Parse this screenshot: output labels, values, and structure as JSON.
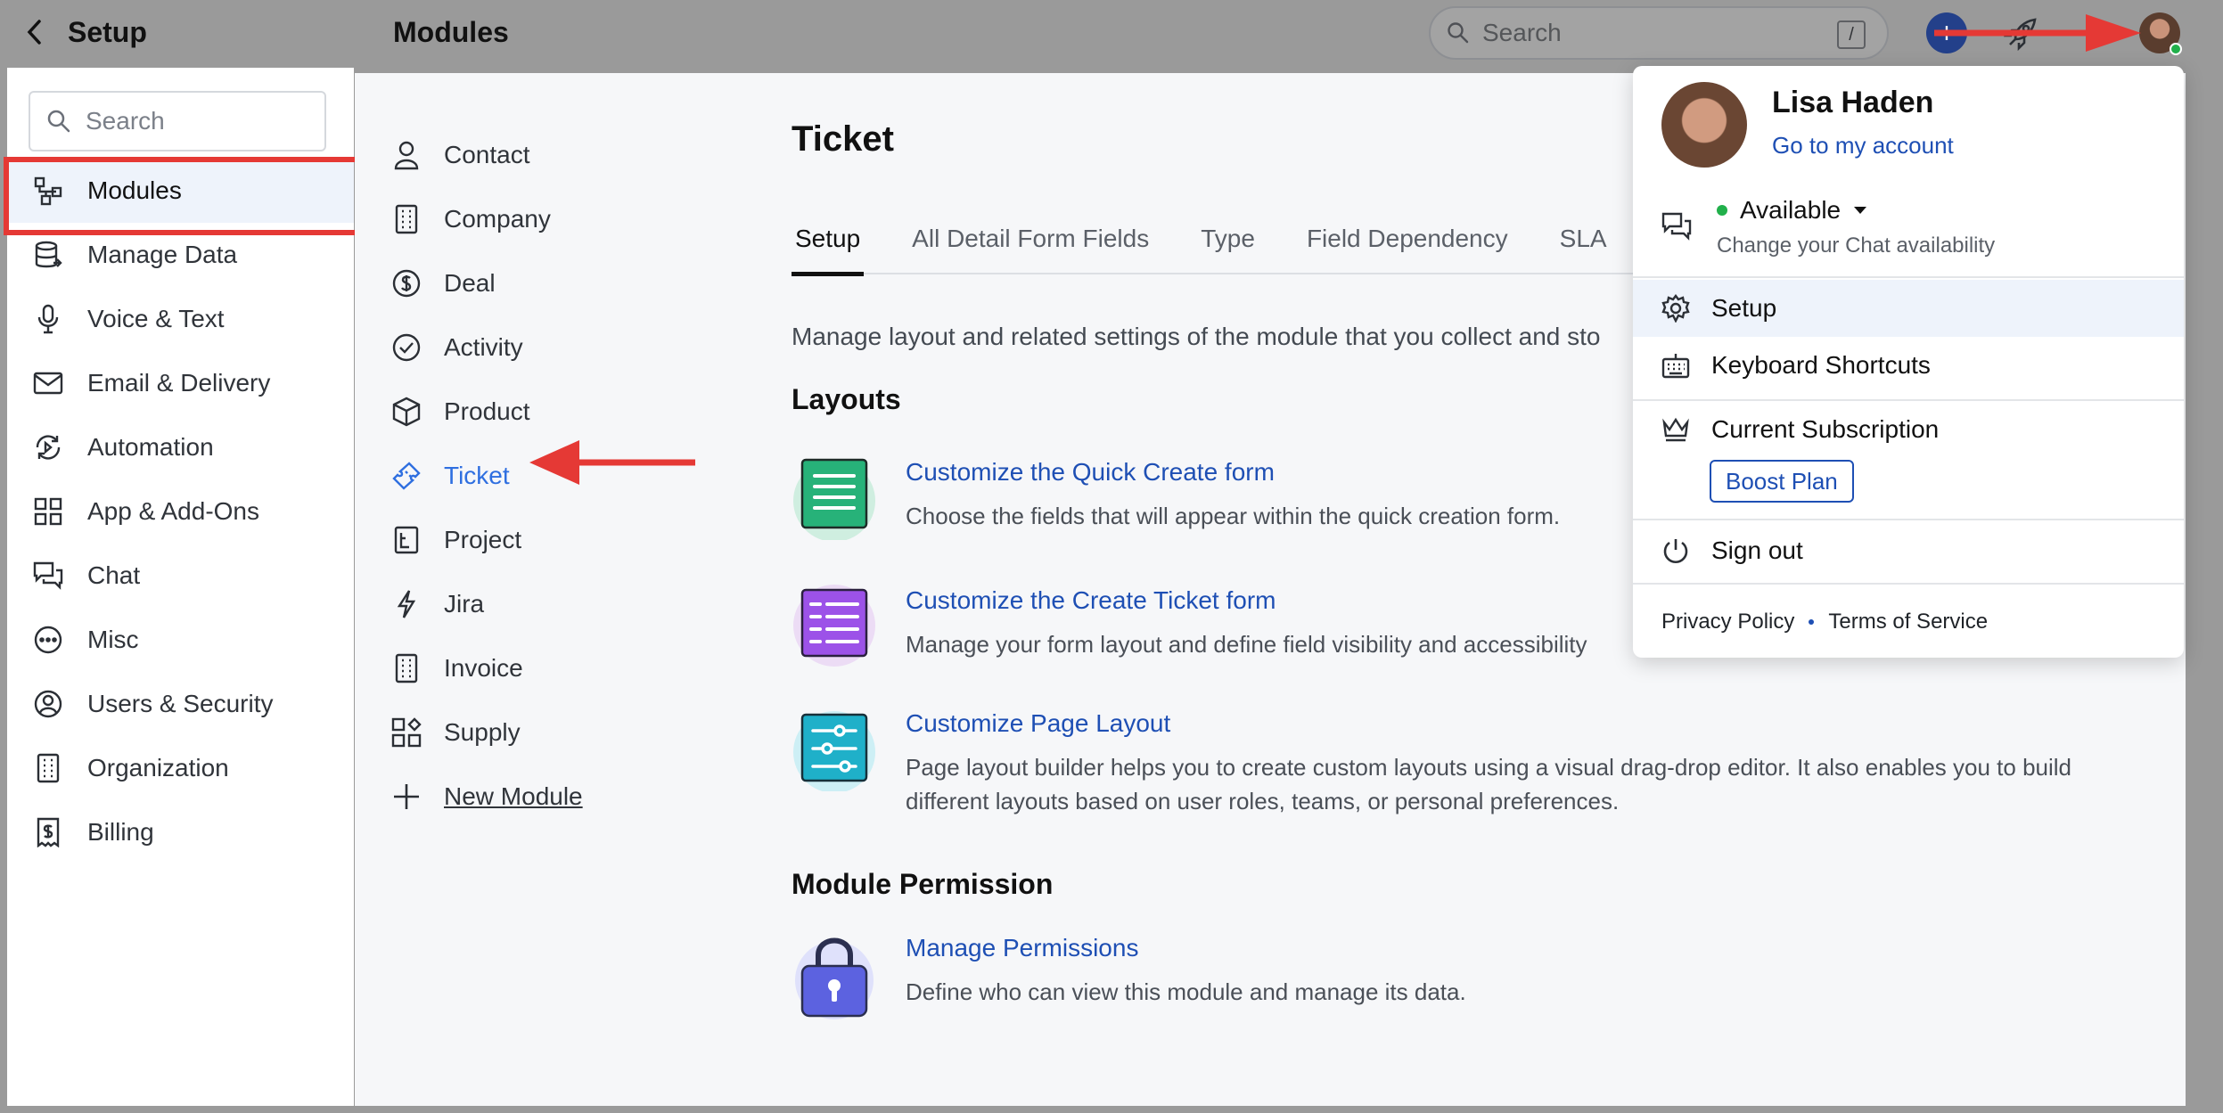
{
  "setup": {
    "title": "Setup",
    "search_placeholder": "Search",
    "items": [
      {
        "label": "Modules",
        "icon": "modules-icon"
      },
      {
        "label": "Manage Data",
        "icon": "database-icon"
      },
      {
        "label": "Voice & Text",
        "icon": "microphone-icon"
      },
      {
        "label": "Email & Delivery",
        "icon": "envelope-icon"
      },
      {
        "label": "Automation",
        "icon": "automation-icon"
      },
      {
        "label": "App & Add-Ons",
        "icon": "apps-grid-icon"
      },
      {
        "label": "Chat",
        "icon": "chat-icon"
      },
      {
        "label": "Misc",
        "icon": "more-circle-icon"
      },
      {
        "label": "Users & Security",
        "icon": "user-circle-icon"
      },
      {
        "label": "Organization",
        "icon": "building-icon"
      },
      {
        "label": "Billing",
        "icon": "receipt-icon"
      }
    ]
  },
  "topbar": {
    "title": "Modules",
    "search_placeholder": "Search",
    "shortcut_key": "/",
    "plus": "+"
  },
  "modules": {
    "items": [
      {
        "label": "Contact",
        "icon": "person-icon"
      },
      {
        "label": "Company",
        "icon": "building-icon"
      },
      {
        "label": "Deal",
        "icon": "dollar-circle-icon"
      },
      {
        "label": "Activity",
        "icon": "check-circle-icon"
      },
      {
        "label": "Product",
        "icon": "box-icon"
      },
      {
        "label": "Ticket",
        "icon": "ticket-icon"
      },
      {
        "label": "Project",
        "icon": "project-icon"
      },
      {
        "label": "Jira",
        "icon": "lightning-icon"
      },
      {
        "label": "Invoice",
        "icon": "invoice-icon"
      },
      {
        "label": "Supply",
        "icon": "supply-grid-icon"
      }
    ],
    "new_module": "New Module"
  },
  "ticket": {
    "title": "Ticket",
    "tabs": [
      "Setup",
      "All Detail Form Fields",
      "Type",
      "Field Dependency",
      "SLA"
    ],
    "description": "Manage layout and related settings of the module that you collect and sto",
    "layouts_title": "Layouts",
    "cards": [
      {
        "title": "Customize the Quick Create form",
        "desc": "Choose the fields that will appear within the quick creation form."
      },
      {
        "title": "Customize the Create Ticket form",
        "desc": "Manage your form layout and define field visibility and accessibility"
      },
      {
        "title": "Customize Page Layout",
        "desc": "Page layout builder helps you to create custom layouts using a visual drag-drop editor. It also enables you to build",
        "desc2": "different layouts based on user roles, teams, or personal preferences."
      }
    ],
    "permission_title": "Module Permission",
    "permission": {
      "title": "Manage Permissions",
      "desc": "Define who can view this module and manage its data."
    }
  },
  "profile_menu": {
    "name": "Lisa Haden",
    "account_link": "Go to my account",
    "status": "Available",
    "status_sub": "Change your Chat availability",
    "setup": "Setup",
    "keyboard_shortcuts": "Keyboard Shortcuts",
    "subscription": "Current Subscription",
    "plan": "Boost Plan",
    "sign_out": "Sign out",
    "privacy": "Privacy Policy",
    "terms": "Terms of Service"
  },
  "colors": {
    "link": "#1e4fb4",
    "active_module": "#2f6fe0",
    "highlight": "#e53935",
    "available": "#21b04b"
  }
}
